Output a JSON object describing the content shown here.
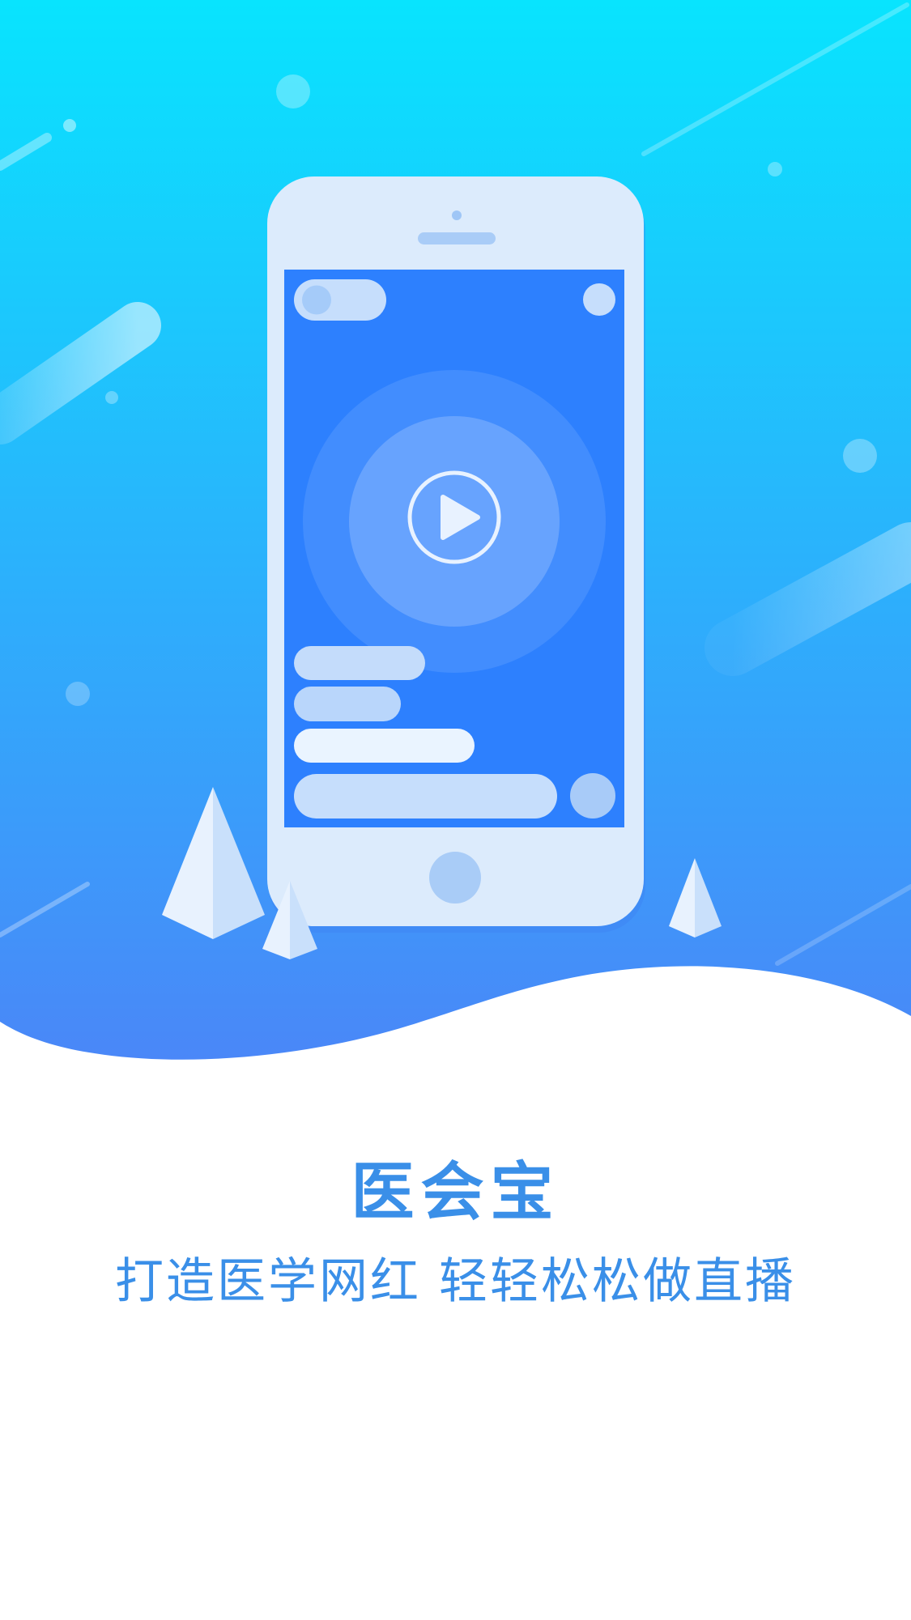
{
  "splash": {
    "app_name": "医会宝",
    "slogan": "打造医学网红 轻轻松松做直播"
  },
  "illustration": {
    "subject": "phone-live-streaming",
    "icons": [
      "play-icon"
    ],
    "colors": {
      "gradient_top": "#08e4fe",
      "gradient_bottom": "#4a87f8",
      "phone_body": "#dcebfc",
      "phone_screen": "#2d80fe",
      "accent_text": "#3a8fe8"
    }
  }
}
